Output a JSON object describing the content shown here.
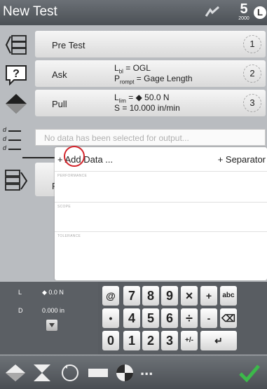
{
  "header": {
    "title": "New Test",
    "logo_big": "5",
    "logo_small": "2000",
    "clock_glyph": "L"
  },
  "steps": [
    {
      "name": "Pre Test",
      "icon": "pretest-icon",
      "number": "1",
      "params": []
    },
    {
      "name": "Ask",
      "icon": "question-icon",
      "number": "2",
      "params": [
        {
          "base": "L",
          "sub": "bl",
          "rest": " = OGL"
        },
        {
          "base": "P",
          "sub": "rompt",
          "rest": " = Gage Length"
        }
      ]
    },
    {
      "name": "Pull",
      "icon": "pull-icon",
      "number": "3",
      "params": [
        {
          "base": "L",
          "sub": "lim",
          "rest": " = ◆ 50.0 N"
        },
        {
          "base": "S",
          "sub": "",
          "rest": " = 10.000 in/min"
        }
      ]
    }
  ],
  "output": {
    "placeholder": "No data has been selected for output...",
    "add_data": "+ Add Data ...",
    "separator": "+ Separator",
    "sections": [
      "PERFORMANCE",
      "SCOPE",
      "TOLERANCE"
    ],
    "d_label": "d"
  },
  "report": {
    "label": "R"
  },
  "live": {
    "load_label": "L",
    "load_value": "◆ 0.0 N",
    "disp_label": "D",
    "disp_value": "0.000 in"
  },
  "keypad": {
    "rows": [
      [
        "@",
        "7",
        "8",
        "9",
        "×",
        "+",
        "abc"
      ],
      [
        "•",
        "4",
        "5",
        "6",
        "÷",
        "-",
        "⌫"
      ],
      [
        "0",
        "1",
        "2",
        "3",
        "+/-",
        "↵"
      ]
    ]
  },
  "toolbar": {
    "items": [
      "pull-diamond-icon",
      "hourglass-icon",
      "cycle-icon",
      "bar-icon",
      "quadrant-icon",
      "more-icon",
      "check-icon"
    ],
    "more_label": "..."
  },
  "colors": {
    "highlight": "#d2232a",
    "check": "#3cb94a"
  }
}
